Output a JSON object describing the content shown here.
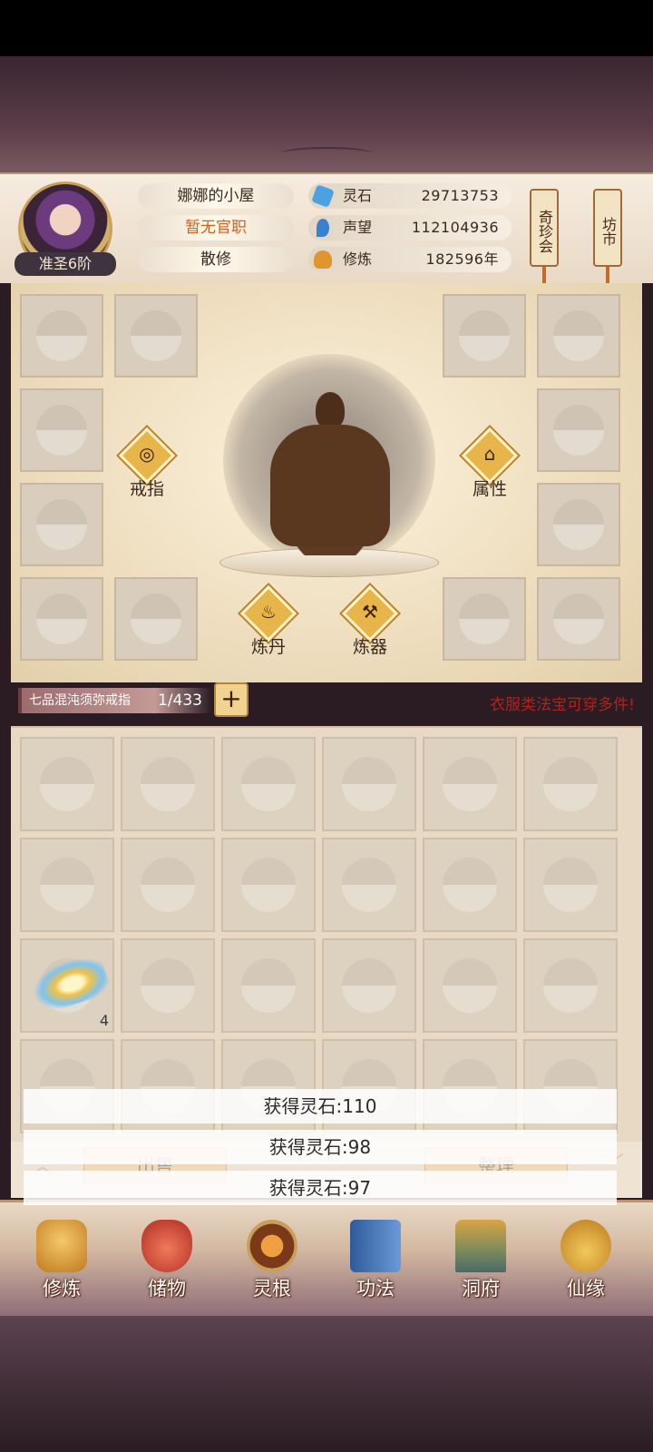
{
  "player": {
    "house_name": "娜娜的小屋",
    "official_title": "暂无官职",
    "cultivator_type": "散修",
    "rank": "准圣6阶"
  },
  "resources": [
    {
      "label": "灵石",
      "value": "29713753",
      "icon": "spirit-stone-icon",
      "color": "#4aa3e0"
    },
    {
      "label": "声望",
      "value": "112104936",
      "icon": "reputation-flame-icon",
      "color": "#3b7fd0"
    },
    {
      "label": "修炼",
      "value": "182596年",
      "icon": "meditation-icon",
      "color": "#e0962e"
    }
  ],
  "side_scrolls": [
    {
      "label": "奇珍会"
    },
    {
      "label": "坊市"
    }
  ],
  "equipment": {
    "buttons": [
      {
        "label": "戒指",
        "icon": "ring-icon",
        "glyph": "◎"
      },
      {
        "label": "属性",
        "icon": "attribute-hat-icon",
        "glyph": "⌂"
      },
      {
        "label": "炼丹",
        "icon": "alchemy-cauldron-icon",
        "glyph": "♨"
      },
      {
        "label": "炼器",
        "icon": "forge-anvil-icon",
        "glyph": "⚒"
      }
    ]
  },
  "ring": {
    "name": "七品混沌须弥戒指",
    "capacity": "1/433",
    "add_label": "+"
  },
  "hint_text": "衣服类法宝可穿多件!",
  "inventory": {
    "item_count": "4"
  },
  "toasts": [
    "获得灵石:110",
    "获得灵石:98",
    "获得灵石:97"
  ],
  "actions": {
    "sell_label": "出售",
    "sort_label": "整理"
  },
  "nav": [
    {
      "label": "修炼",
      "icon": "cultivation-monk-icon",
      "color": "#e0a02e"
    },
    {
      "label": "储物",
      "icon": "storage-bag-icon",
      "color": "#d6473a"
    },
    {
      "label": "灵根",
      "icon": "spirit-root-icon",
      "color": "#d6692a"
    },
    {
      "label": "功法",
      "icon": "technique-book-icon",
      "color": "#4a78b8"
    },
    {
      "label": "洞府",
      "icon": "cave-mansion-icon",
      "color": "#c59a3a"
    },
    {
      "label": "仙缘",
      "icon": "immortal-gourd-icon",
      "color": "#e0b040"
    }
  ]
}
